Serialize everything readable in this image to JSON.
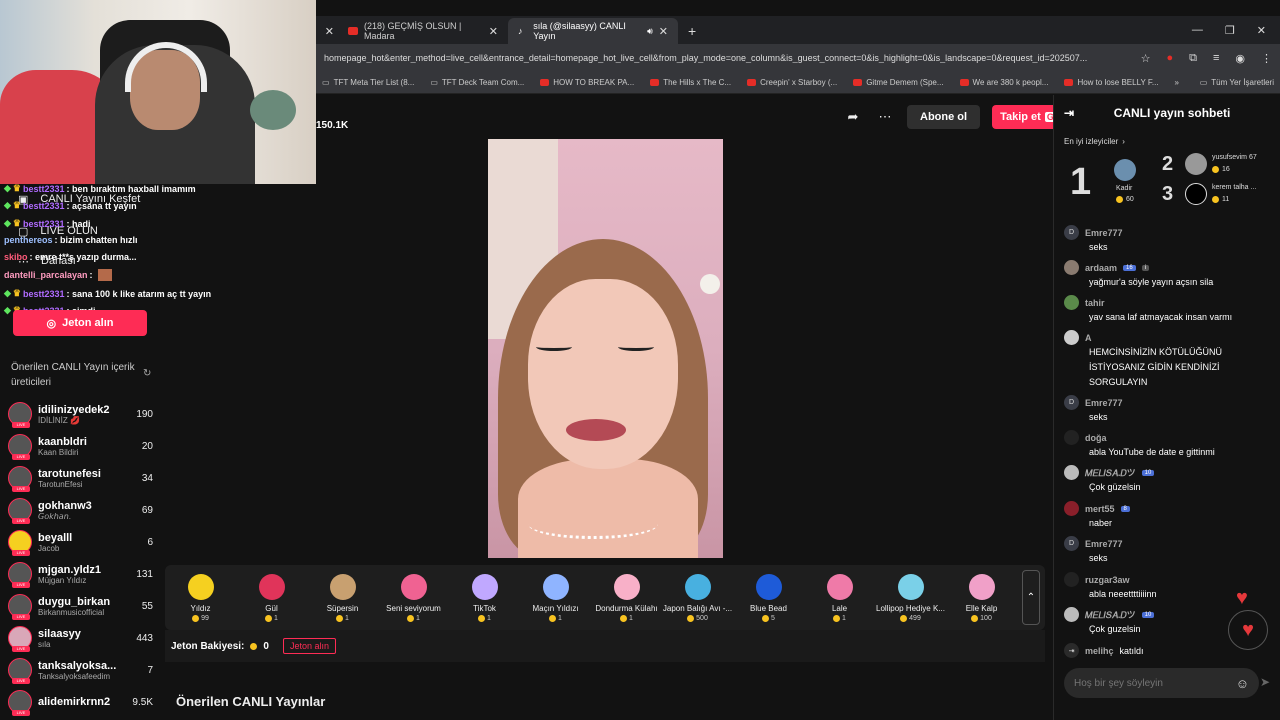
{
  "browser": {
    "tabs": [
      {
        "title": "(218) GEÇMİŞ OLSUN | Madara"
      },
      {
        "title": "sıla (@silaasyy) CANLI Yayın"
      }
    ],
    "url": "homepage_hot&enter_method=live_cell&entrance_detail=homepage_hot_live_cell&from_play_mode=one_column&is_guest_connect=0&is_highlight=0&is_landscape=0&request_id=202507...",
    "bookmarks": [
      "TFT Meta Tier List (8...",
      "TFT Deck Team Com...",
      "HOW TO BREAK PA...",
      "The Hills x The C...",
      "Creepin' x Starboy (...",
      "Gitme Demem (Spe...",
      "We are 380 k peopl...",
      "How to lose BELLY F..."
    ],
    "bookmarks_more": "»",
    "all_bookmarks": "Tüm Yer İşaretleri"
  },
  "stream": {
    "viewers": "150.1K",
    "subscribe": "Abone ol",
    "follow": "Takip et",
    "follow_key": "G"
  },
  "sidebar": {
    "nav": [
      "CANLI Yayını Keşfet",
      "LIVE OLUN",
      "Dahası"
    ],
    "jeton_button": "Jeton alın",
    "recommend_title": "Önerilen CANLI Yayın içerik üreticileri",
    "creators": [
      {
        "name": "idilinizyedek2",
        "sub": "İDİLİNİZ 💋",
        "count": "190"
      },
      {
        "name": "kaanbldri",
        "sub": "Kaan Bildiri",
        "count": "20"
      },
      {
        "name": "tarotunefesi",
        "sub": "TarotunEfesi",
        "count": "34"
      },
      {
        "name": "gokhanw3",
        "sub": "𝘎𝘰𝘬𝘩𝘢𝘯.",
        "count": "69"
      },
      {
        "name": "beyalll",
        "sub": "Jacob",
        "count": "6"
      },
      {
        "name": "mjgan.yldz1",
        "sub": "Müjgan Yıldız",
        "count": "131"
      },
      {
        "name": "duygu_birkan",
        "sub": "Birkanmusicofficial",
        "count": "55"
      },
      {
        "name": "silaasyy",
        "sub": "sıla",
        "count": "443"
      },
      {
        "name": "tanksalyoksa...",
        "sub": "Tanksalyoksafeedim",
        "count": "7"
      },
      {
        "name": "alidemirkrnn2",
        "sub": "",
        "count": "9.5K"
      }
    ]
  },
  "overlay_chat": [
    {
      "user": "bestt2331",
      "text": ": ben bıraktım haxball imamım"
    },
    {
      "user": "bestt2331",
      "text": ": açsana tt yayın"
    },
    {
      "user": "bestt2331",
      "text": ": hadi"
    },
    {
      "user": "penthereos",
      "text": ": bizim chatten hızlı"
    },
    {
      "user": "skibo",
      "text": ": emre t**ş yazıp durma..."
    },
    {
      "user": "dantelli_parcalayan",
      "text": ":"
    },
    {
      "user": "bestt2331",
      "text": ": sana 100 k like atarım aç tt yayın"
    },
    {
      "user": "bestt2331",
      "text": ": şimdi"
    }
  ],
  "gifts": [
    {
      "name": "Yıldız",
      "price": "99",
      "color": "#f5d020"
    },
    {
      "name": "Gül",
      "price": "1",
      "color": "#e0345a"
    },
    {
      "name": "Süpersin",
      "price": "1",
      "color": "#c8a070"
    },
    {
      "name": "Seni seviyorum",
      "price": "1",
      "color": "#f06292"
    },
    {
      "name": "TikTok",
      "price": "1",
      "color": "#c0a8ff"
    },
    {
      "name": "Maçın Yıldızı",
      "price": "1",
      "color": "#8fb4ff"
    },
    {
      "name": "Dondurma Külahı",
      "price": "1",
      "color": "#f8b0c8"
    },
    {
      "name": "Japon Balığı Avı -...",
      "price": "500",
      "color": "#48b0e0"
    },
    {
      "name": "Blue Bead",
      "price": "5",
      "color": "#1e5bd8"
    },
    {
      "name": "Lale",
      "price": "1",
      "color": "#ef7aa8"
    },
    {
      "name": "Lollipop Hediye K...",
      "price": "499",
      "color": "#7ad0e8"
    },
    {
      "name": "Elle Kalp",
      "price": "100",
      "color": "#f0a0c8"
    }
  ],
  "gift_scroll": "⌃",
  "balance": {
    "label": "Jeton Bakiyesi:",
    "value": "0",
    "button": "Jeton alın"
  },
  "recommended_live": "Önerilen CANLI Yayınlar",
  "chat": {
    "title": "CANLI yayın sohbeti",
    "top_viewers_label": "En iyi izleyiciler",
    "top_viewers": [
      {
        "rank": "1",
        "name": "Kadir",
        "coins": "60"
      },
      {
        "rank": "2",
        "name": "yusufsevim 67",
        "coins": "16"
      },
      {
        "rank": "3",
        "name": "kerem talha ...",
        "coins": "11"
      }
    ],
    "messages": [
      {
        "user": "Emre777",
        "badge": "",
        "text": "seks",
        "initial": "D"
      },
      {
        "user": "ardaam",
        "badge": "16",
        "text": "yağmur'a söyle yayın açsın sila",
        "initial": ""
      },
      {
        "user": "tahir",
        "badge": "",
        "text": "yav sana laf atmayacak insan varmı",
        "initial": ""
      },
      {
        "user": "A",
        "badge": "",
        "text": "HEMCİNSİNİZİN KÖTÜLÜĞÜNÜ İSTİYOSANIZ GİDİN KENDİNİZİ SORGULAYIN",
        "initial": ""
      },
      {
        "user": "Emre777",
        "badge": "",
        "text": "seks",
        "initial": "D"
      },
      {
        "user": "doğa",
        "badge": "",
        "text": "abla YouTube de date e gittinmi",
        "initial": ""
      },
      {
        "user": "𝑀𝐸𝐿𝐼𝑆𝐴.𝐷ツ",
        "badge": "10",
        "text": "Çok güzelsin",
        "initial": ""
      },
      {
        "user": "mert55",
        "badge": "8",
        "text": "naber",
        "initial": ""
      },
      {
        "user": "Emre777",
        "badge": "",
        "text": "seks",
        "initial": "D"
      },
      {
        "user": "ruzgar3aw",
        "badge": "",
        "text": "abla neeettttiiiinn",
        "initial": ""
      },
      {
        "user": "𝑀𝐸𝐿𝐼𝑆𝐴.𝐷ツ",
        "badge": "10",
        "text": "Çok guzelsin",
        "initial": ""
      }
    ],
    "join": {
      "user": "melihç",
      "text": "katıldı"
    },
    "input_placeholder": "Hoş bir şey söyleyin"
  }
}
